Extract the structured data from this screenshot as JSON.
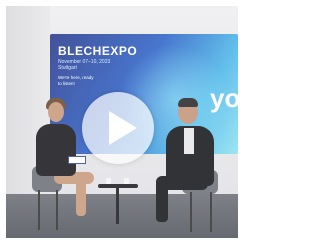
{
  "video": {
    "screen_title": "BLECHEXPO",
    "screen_dates": "November 07–10, 2023",
    "screen_city": "Stuttgart",
    "screen_tagline": "We're here, ready to listen!",
    "screen_big_text": "yo wh",
    "play_icon": "play-icon",
    "colors": {
      "screen_blue": "#2f64c8",
      "screen_cyan": "#4db6e8",
      "floor": "#5c5e66"
    }
  }
}
